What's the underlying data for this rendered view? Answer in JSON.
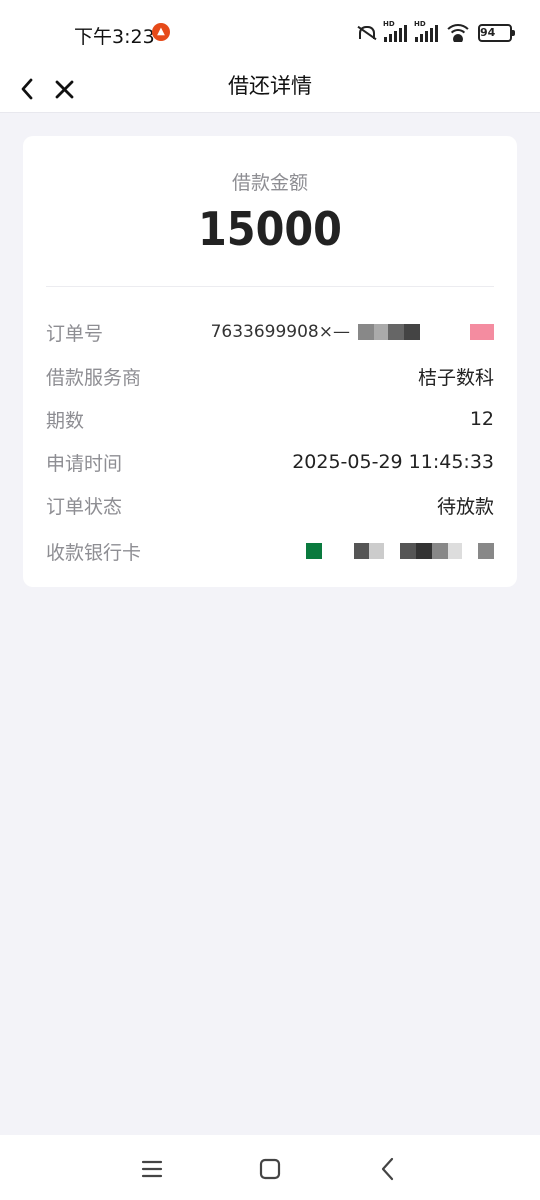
{
  "status_bar": {
    "time": "下午3:23",
    "battery": "94",
    "hd1": "HD",
    "hd2": "HD"
  },
  "nav": {
    "title": "借还详情"
  },
  "loan": {
    "amount_label": "借款金额",
    "amount": "15000"
  },
  "details": [
    {
      "key": "订单号",
      "value": "7633699908×—"
    },
    {
      "key": "借款服务商",
      "value": "桔子数科"
    },
    {
      "key": "期数",
      "value": "12"
    },
    {
      "key": "申请时间",
      "value": "2025-05-29 11:45:33"
    },
    {
      "key": "订单状态",
      "value": "待放款"
    },
    {
      "key": "收款银行卡",
      "value": ""
    }
  ],
  "colors": {
    "background": "#f3f3f8",
    "card": "#ffffff",
    "label_gray": "#8e8e93",
    "text": "#222222"
  },
  "icons": [
    "back-icon",
    "close-icon",
    "menu-icon",
    "home-icon",
    "back-nav-icon"
  ]
}
